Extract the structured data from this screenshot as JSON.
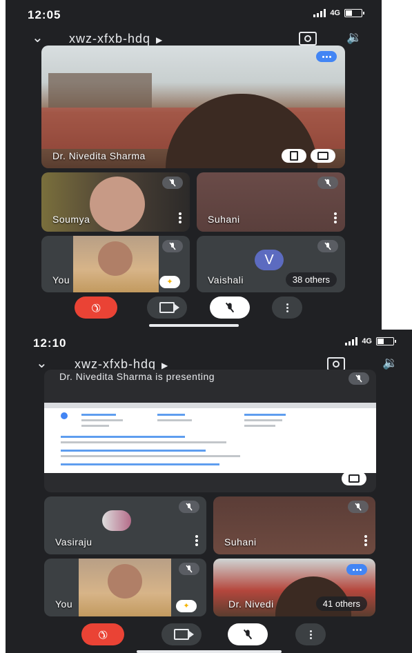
{
  "screen1": {
    "time": "12:05",
    "network": "4G",
    "meeting_code": "xwz-xfxb-hdq",
    "tiles": [
      {
        "name": "Dr. Nivedita Sharma"
      },
      {
        "name": "Soumya"
      },
      {
        "name": "Suhani"
      },
      {
        "name": "You"
      },
      {
        "name": "Vaishali",
        "avatar_letter": "V",
        "others": "38 others"
      }
    ]
  },
  "screen2": {
    "time": "12:10",
    "network": "4G",
    "meeting_code": "xwz-xfxb-hdq",
    "presenting_text": "Dr. Nivedita Sharma is presenting",
    "tiles": [
      {
        "name": "Vasiraju"
      },
      {
        "name": "Suhani"
      },
      {
        "name": "You"
      },
      {
        "name": "Dr. Nivedi",
        "others": "41 others"
      }
    ]
  },
  "colors": {
    "background": "#202124",
    "tile": "#3c4043",
    "end_call": "#ea4335",
    "accent": "#4285f4"
  },
  "icons": [
    "chevron-down-icon",
    "switch-camera-icon",
    "speaker-icon",
    "mic-off-icon",
    "pin-icon",
    "fullscreen-icon",
    "end-call-icon",
    "video-icon",
    "more-vert-icon"
  ]
}
